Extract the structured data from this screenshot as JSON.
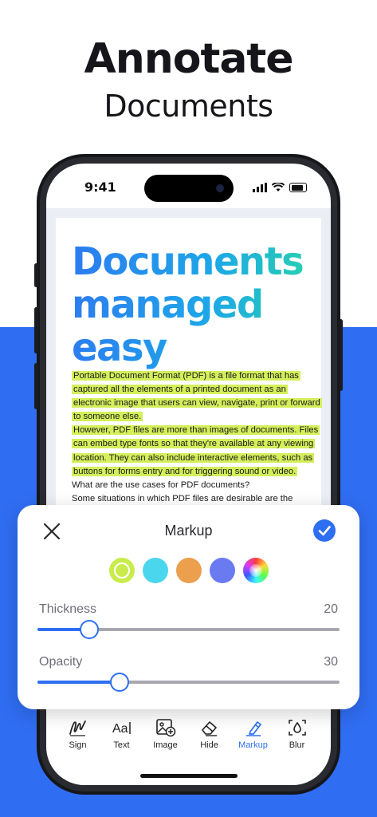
{
  "headline": {
    "title": "Annotate",
    "subtitle": "Documents"
  },
  "status_bar": {
    "time": "9:41"
  },
  "document": {
    "title_lines": [
      "Documents",
      "managed",
      "easy"
    ],
    "highlighted_1": "Portable Document Format (PDF) is a file format that has captured all the elements of a printed document as an electronic image that users can view, navigate, print or forward to someone else.",
    "highlighted_2": "However, PDF files are more than images of documents. Files can embed type fonts so that they're available at any viewing location. They can also include interactive elements, such as buttons for forms entry and for triggering sound or video.",
    "plain_1": "What are the use cases for PDF documents?",
    "plain_2": "Some situations in which PDF files are desirable are the",
    "highlight_color": "#d4ef5b"
  },
  "markup_panel": {
    "title": "Markup",
    "colors": [
      "#c9ec4c",
      "#4ad6ec",
      "#ec9f4c",
      "#6a7bf2"
    ],
    "selected_color_index": 0,
    "accent": "#2d6ef2",
    "thickness": {
      "label": "Thickness",
      "value": "20",
      "level": 0.17
    },
    "opacity": {
      "label": "Opacity",
      "value": "30",
      "level": 0.27
    }
  },
  "toolbar": {
    "items": [
      {
        "label": "Sign",
        "icon": "signature-icon"
      },
      {
        "label": "Text",
        "icon": "text-icon"
      },
      {
        "label": "Image",
        "icon": "image-add-icon"
      },
      {
        "label": "Hide",
        "icon": "eraser-icon"
      },
      {
        "label": "Markup",
        "icon": "marker-icon",
        "active": true
      },
      {
        "label": "Blur",
        "icon": "blur-drop-icon"
      }
    ]
  }
}
